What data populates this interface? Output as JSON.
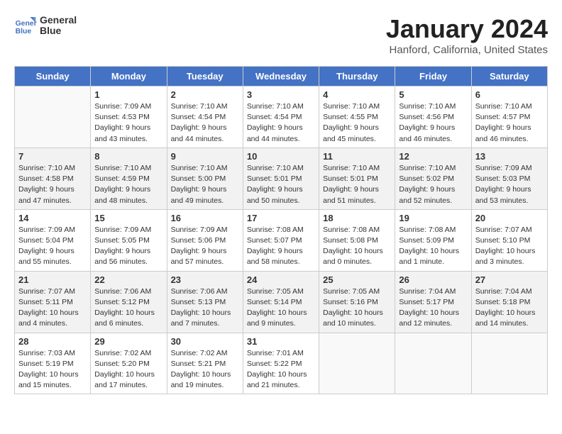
{
  "header": {
    "logo": {
      "line1": "General",
      "line2": "Blue"
    },
    "title": "January 2024",
    "location": "Hanford, California, United States"
  },
  "weekdays": [
    "Sunday",
    "Monday",
    "Tuesday",
    "Wednesday",
    "Thursday",
    "Friday",
    "Saturday"
  ],
  "weeks": [
    [
      {
        "day": "",
        "empty": true
      },
      {
        "day": "1",
        "sunrise": "7:09 AM",
        "sunset": "4:53 PM",
        "daylight": "9 hours and 43 minutes."
      },
      {
        "day": "2",
        "sunrise": "7:10 AM",
        "sunset": "4:54 PM",
        "daylight": "9 hours and 44 minutes."
      },
      {
        "day": "3",
        "sunrise": "7:10 AM",
        "sunset": "4:54 PM",
        "daylight": "9 hours and 44 minutes."
      },
      {
        "day": "4",
        "sunrise": "7:10 AM",
        "sunset": "4:55 PM",
        "daylight": "9 hours and 45 minutes."
      },
      {
        "day": "5",
        "sunrise": "7:10 AM",
        "sunset": "4:56 PM",
        "daylight": "9 hours and 46 minutes."
      },
      {
        "day": "6",
        "sunrise": "7:10 AM",
        "sunset": "4:57 PM",
        "daylight": "9 hours and 46 minutes."
      }
    ],
    [
      {
        "day": "7",
        "sunrise": "7:10 AM",
        "sunset": "4:58 PM",
        "daylight": "9 hours and 47 minutes."
      },
      {
        "day": "8",
        "sunrise": "7:10 AM",
        "sunset": "4:59 PM",
        "daylight": "9 hours and 48 minutes."
      },
      {
        "day": "9",
        "sunrise": "7:10 AM",
        "sunset": "5:00 PM",
        "daylight": "9 hours and 49 minutes."
      },
      {
        "day": "10",
        "sunrise": "7:10 AM",
        "sunset": "5:01 PM",
        "daylight": "9 hours and 50 minutes."
      },
      {
        "day": "11",
        "sunrise": "7:10 AM",
        "sunset": "5:01 PM",
        "daylight": "9 hours and 51 minutes."
      },
      {
        "day": "12",
        "sunrise": "7:10 AM",
        "sunset": "5:02 PM",
        "daylight": "9 hours and 52 minutes."
      },
      {
        "day": "13",
        "sunrise": "7:09 AM",
        "sunset": "5:03 PM",
        "daylight": "9 hours and 53 minutes."
      }
    ],
    [
      {
        "day": "14",
        "sunrise": "7:09 AM",
        "sunset": "5:04 PM",
        "daylight": "9 hours and 55 minutes."
      },
      {
        "day": "15",
        "sunrise": "7:09 AM",
        "sunset": "5:05 PM",
        "daylight": "9 hours and 56 minutes."
      },
      {
        "day": "16",
        "sunrise": "7:09 AM",
        "sunset": "5:06 PM",
        "daylight": "9 hours and 57 minutes."
      },
      {
        "day": "17",
        "sunrise": "7:08 AM",
        "sunset": "5:07 PM",
        "daylight": "9 hours and 58 minutes."
      },
      {
        "day": "18",
        "sunrise": "7:08 AM",
        "sunset": "5:08 PM",
        "daylight": "10 hours and 0 minutes."
      },
      {
        "day": "19",
        "sunrise": "7:08 AM",
        "sunset": "5:09 PM",
        "daylight": "10 hours and 1 minute."
      },
      {
        "day": "20",
        "sunrise": "7:07 AM",
        "sunset": "5:10 PM",
        "daylight": "10 hours and 3 minutes."
      }
    ],
    [
      {
        "day": "21",
        "sunrise": "7:07 AM",
        "sunset": "5:11 PM",
        "daylight": "10 hours and 4 minutes."
      },
      {
        "day": "22",
        "sunrise": "7:06 AM",
        "sunset": "5:12 PM",
        "daylight": "10 hours and 6 minutes."
      },
      {
        "day": "23",
        "sunrise": "7:06 AM",
        "sunset": "5:13 PM",
        "daylight": "10 hours and 7 minutes."
      },
      {
        "day": "24",
        "sunrise": "7:05 AM",
        "sunset": "5:14 PM",
        "daylight": "10 hours and 9 minutes."
      },
      {
        "day": "25",
        "sunrise": "7:05 AM",
        "sunset": "5:16 PM",
        "daylight": "10 hours and 10 minutes."
      },
      {
        "day": "26",
        "sunrise": "7:04 AM",
        "sunset": "5:17 PM",
        "daylight": "10 hours and 12 minutes."
      },
      {
        "day": "27",
        "sunrise": "7:04 AM",
        "sunset": "5:18 PM",
        "daylight": "10 hours and 14 minutes."
      }
    ],
    [
      {
        "day": "28",
        "sunrise": "7:03 AM",
        "sunset": "5:19 PM",
        "daylight": "10 hours and 15 minutes."
      },
      {
        "day": "29",
        "sunrise": "7:02 AM",
        "sunset": "5:20 PM",
        "daylight": "10 hours and 17 minutes."
      },
      {
        "day": "30",
        "sunrise": "7:02 AM",
        "sunset": "5:21 PM",
        "daylight": "10 hours and 19 minutes."
      },
      {
        "day": "31",
        "sunrise": "7:01 AM",
        "sunset": "5:22 PM",
        "daylight": "10 hours and 21 minutes."
      },
      {
        "day": "",
        "empty": true
      },
      {
        "day": "",
        "empty": true
      },
      {
        "day": "",
        "empty": true
      }
    ]
  ],
  "labels": {
    "sunrise_prefix": "Sunrise: ",
    "sunset_prefix": "Sunset: ",
    "daylight_prefix": "Daylight: "
  }
}
